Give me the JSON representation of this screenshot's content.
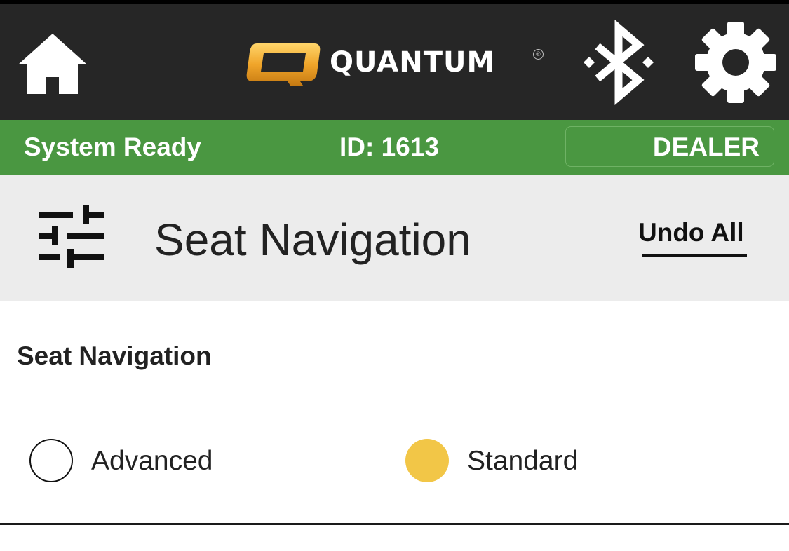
{
  "header": {
    "logo_text": "QUANTUM",
    "logo_registered": "®",
    "icons": [
      "home-icon",
      "quantum-logo",
      "bluetooth-icon",
      "gear-icon"
    ]
  },
  "status": {
    "text": "System Ready",
    "id_text": "ID: 1613",
    "mode_label": "DEALER"
  },
  "section": {
    "title": "Seat Navigation",
    "undo_label": "Undo All",
    "icon": "sliders-icon"
  },
  "content": {
    "heading": "Seat Navigation",
    "options": [
      {
        "label": "Advanced",
        "selected": false
      },
      {
        "label": "Standard",
        "selected": true
      }
    ]
  },
  "colors": {
    "header_bg": "#262626",
    "status_bg": "#4a9741",
    "section_bg": "#ececec",
    "accent_yellow": "#f2c647",
    "logo_gold": "#f0a52a"
  }
}
